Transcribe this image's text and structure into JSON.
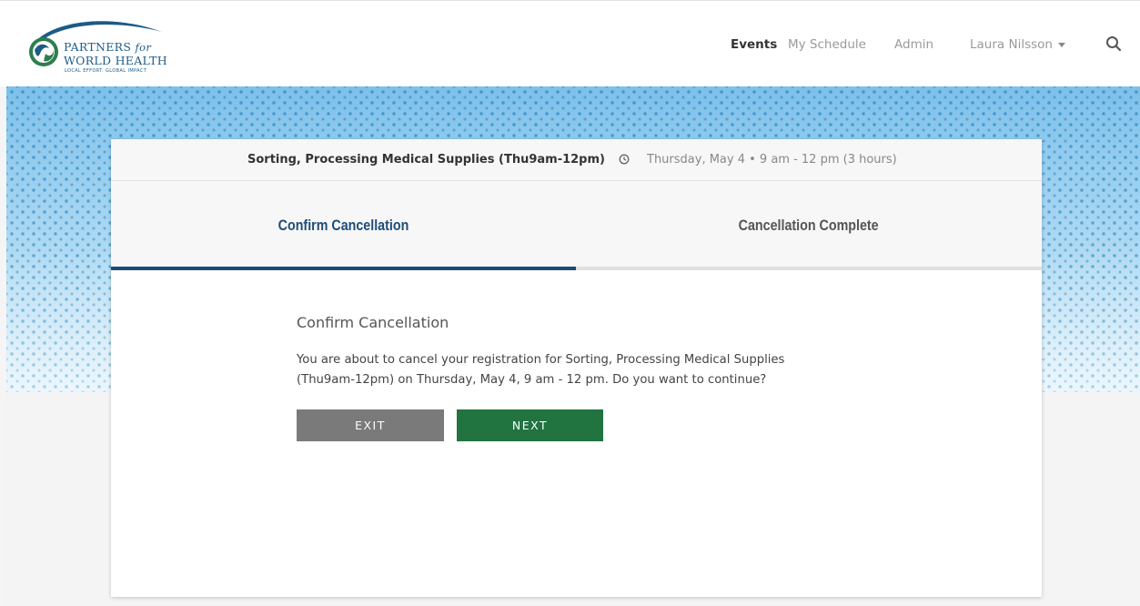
{
  "header": {
    "logo": {
      "line1": "PARTNERS",
      "line1_for": "for",
      "line2": "WORLD HEALTH",
      "tagline": "LOCAL EFFORT. GLOBAL IMPACT"
    },
    "nav": {
      "events": "Events",
      "my_schedule": "My Schedule",
      "admin": "Admin",
      "user": "Laura Nilsson"
    },
    "search_icon": "search-icon"
  },
  "event": {
    "name": "Sorting, Processing Medical Supplies (Thu9am-12pm)",
    "time": "Thursday, May 4 • 9 am - 12 pm (3 hours)",
    "time_icon": "clock-icon"
  },
  "tabs": [
    {
      "label": "Confirm Cancellation",
      "active": true
    },
    {
      "label": "Cancellation Complete",
      "active": false
    }
  ],
  "content": {
    "title": "Confirm Cancellation",
    "message": "You are about to cancel your registration for Sorting, Processing Medical Supplies (Thu9am-12pm) on Thursday, May 4, 9 am - 12 pm. Do you want to continue?"
  },
  "buttons": {
    "exit": "EXIT",
    "next": "NEXT"
  },
  "colors": {
    "active_tab": "#1b4b73",
    "next_button": "#217340",
    "exit_button": "#7a7a7a",
    "brand": "#1d5b87"
  }
}
